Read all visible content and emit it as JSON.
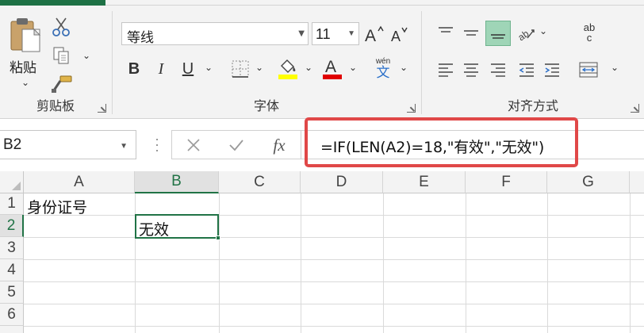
{
  "ribbon": {
    "clipboard": {
      "group_label": "剪贴板",
      "paste_label": "粘贴",
      "icons": [
        "paste-icon",
        "cut-icon",
        "copy-icon",
        "format-painter-icon"
      ]
    },
    "font": {
      "group_label": "字体",
      "font_name": "等线",
      "font_size": "11",
      "bold": "B",
      "italic": "I",
      "underline": "U",
      "font_color_letter": "A",
      "phonetic_top": "wén",
      "phonetic_char": "文",
      "highlight_color": "#ffff00",
      "font_color": "#e00000"
    },
    "alignment": {
      "group_label": "对齐方式",
      "wrap_top": "ab",
      "wrap_bottom": "c"
    }
  },
  "formula_bar": {
    "name_box": "B2",
    "fx_label": "fx",
    "formula": "=IF(LEN(A2)=18,\"有效\",\"无效\")"
  },
  "sheet": {
    "columns": [
      "A",
      "B",
      "C",
      "D",
      "E",
      "F",
      "G"
    ],
    "rows": [
      "1",
      "2",
      "3",
      "4",
      "5",
      "6"
    ],
    "active_cell": "B2",
    "cells": {
      "A1": "身份证号",
      "B2": "无效"
    }
  },
  "accent_color": "#217346",
  "highlight_box_color": "#e04848"
}
